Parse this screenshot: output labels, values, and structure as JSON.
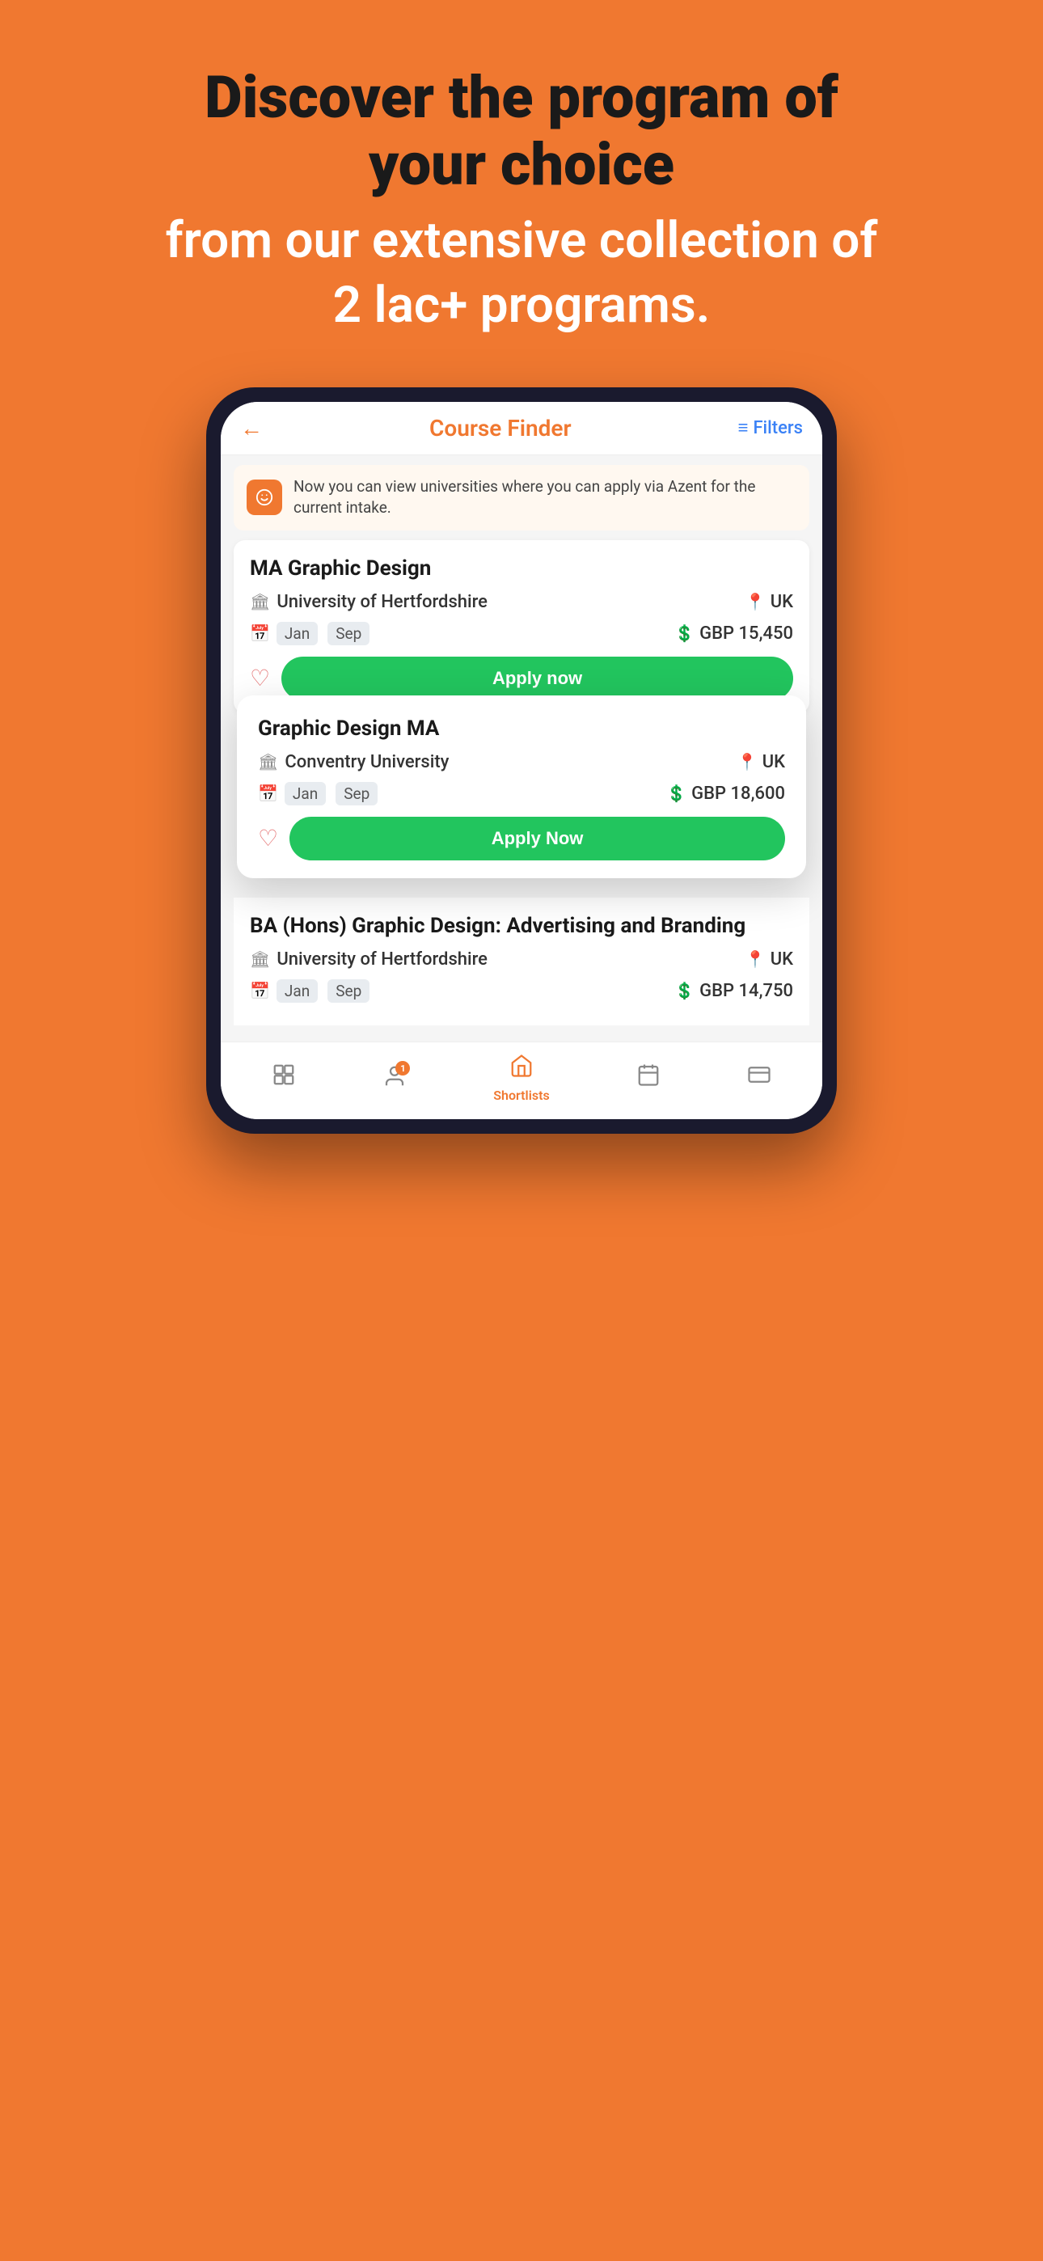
{
  "headline": {
    "line1": "Discover the program of",
    "line2": "your choice",
    "line3": "from our extensive collection of",
    "line4": "2 lac+ programs."
  },
  "header": {
    "title": "Course Finder",
    "filters_label": "Filters",
    "back_icon": "←"
  },
  "banner": {
    "text": "Now you can view universities where you can apply via Azent for the current intake."
  },
  "course1": {
    "title": "MA Graphic Design",
    "university": "University of Hertfordshire",
    "location": "UK",
    "intakes": [
      "Jan",
      "Sep"
    ],
    "fee": "GBP 15,450",
    "apply_label": "Apply now"
  },
  "course2": {
    "title": "Graphic Design MA",
    "university": "Conventry University",
    "location": "UK",
    "intakes": [
      "Jan",
      "Sep"
    ],
    "fee": "GBP 18,600",
    "apply_label": "Apply Now"
  },
  "course3": {
    "title": "BA (Hons) Graphic Design: Advertising and Branding",
    "university": "University of Hertfordshire",
    "location": "UK",
    "intakes": [
      "Jan",
      "Sep"
    ],
    "fee": "GBP 14,750"
  },
  "nav": {
    "items": [
      {
        "label": "",
        "icon": "grid",
        "active": false
      },
      {
        "label": "",
        "icon": "person",
        "active": false,
        "badge": "1"
      },
      {
        "label": "Shortlists",
        "icon": "building",
        "active": true
      },
      {
        "label": "",
        "icon": "calendar",
        "active": false
      },
      {
        "label": "",
        "icon": "card",
        "active": false
      }
    ]
  }
}
